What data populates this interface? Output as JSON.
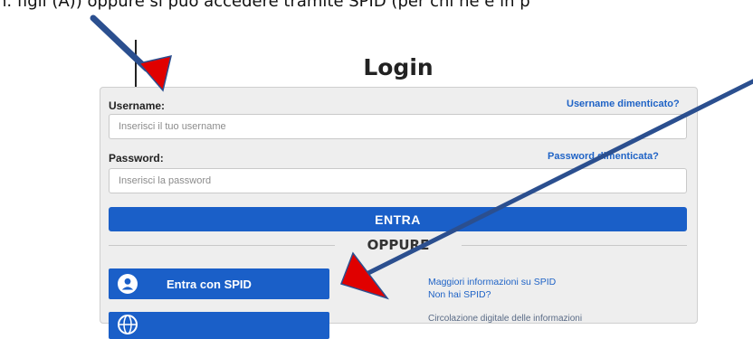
{
  "caption": "n. figli (A)) oppure si può accedere tramite SPID (per chi ne è in p",
  "login": {
    "title": "Login",
    "username_label": "Username:",
    "username_placeholder": "Inserisci il tuo username",
    "username_forgot": "Username dimenticato?",
    "password_label": "Password:",
    "password_placeholder": "Inserisci la password",
    "password_forgot": "Password dimenticata?",
    "submit_label": "ENTRA",
    "or_label": "OPPURE"
  },
  "spid": {
    "button_label": "Entra con SPID",
    "info_link": "Maggiori informazioni su SPID",
    "no_spid_link": "Non hai SPID?",
    "cut_text": "Circolazione digitale delle informazioni"
  },
  "colors": {
    "primary": "#1a5fc8",
    "link": "#1f63c6",
    "arrow_blue": "#2b4f8f",
    "arrow_red": "#e00000"
  },
  "icons": {
    "spid_user": "user-circle-icon",
    "globe": "globe-icon"
  }
}
